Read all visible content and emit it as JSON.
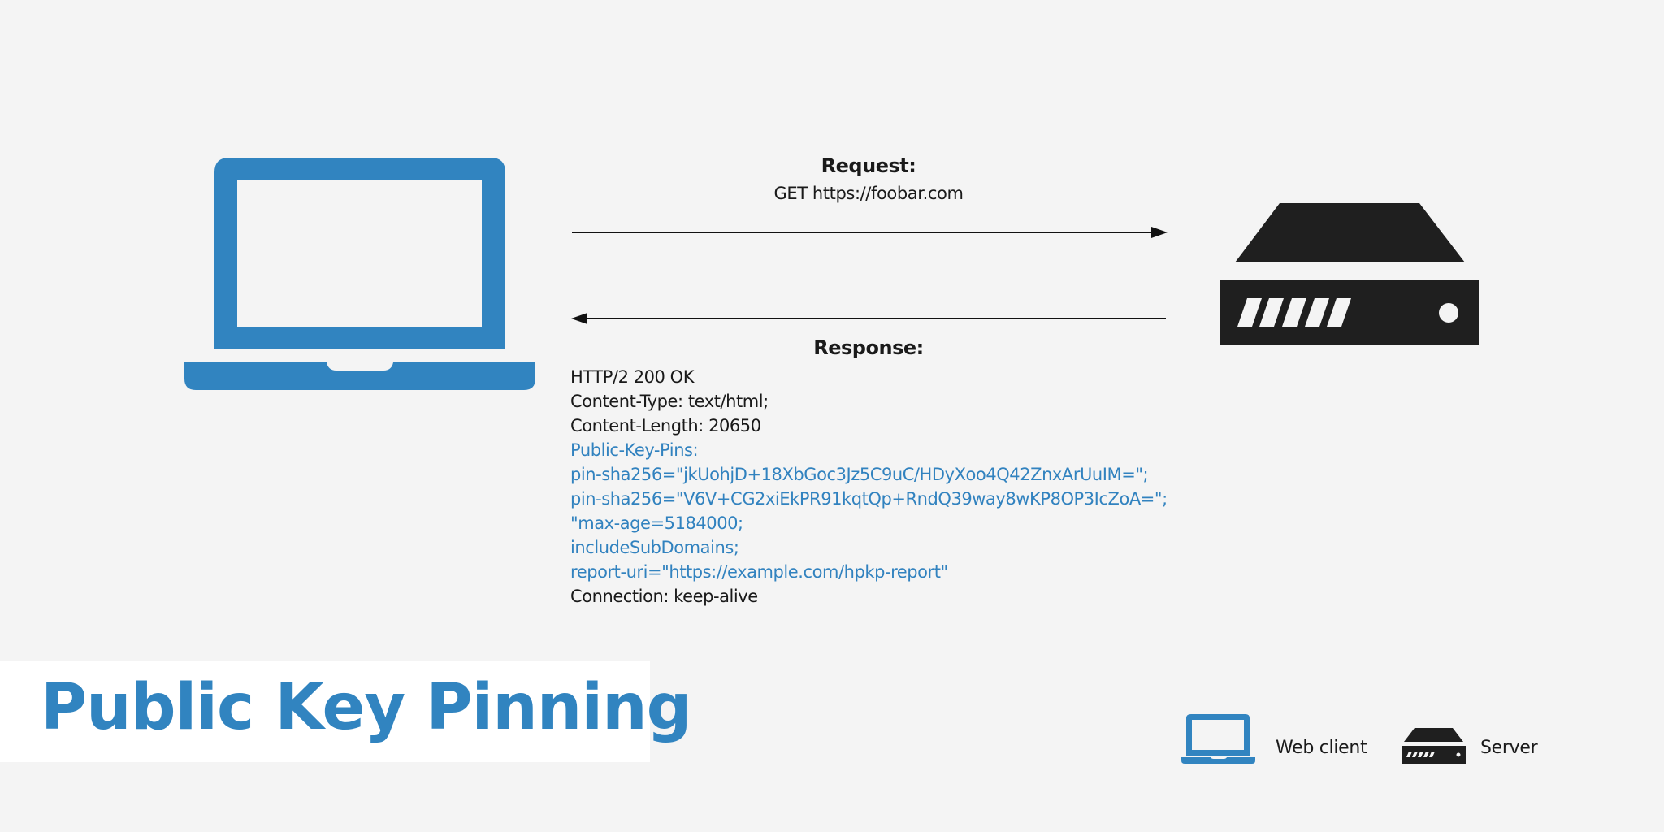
{
  "title": "Public Key Pinning",
  "colors": {
    "accent": "#3184c0",
    "server": "#1f1f1f",
    "background": "#f4f4f4",
    "text": "#1a1a1a"
  },
  "client": {
    "icon": "laptop-icon",
    "label": "Web client"
  },
  "server": {
    "icon": "server-icon",
    "label": "Server"
  },
  "request": {
    "heading": "Request:",
    "line": "GET https://foobar.com",
    "direction": "client-to-server"
  },
  "response": {
    "heading": "Response:",
    "direction": "server-to-client",
    "lines": [
      {
        "text": "HTTP/2 200 OK",
        "highlight": false
      },
      {
        "text": "Content-Type: text/html;",
        "highlight": false
      },
      {
        "text": "Content-Length: 20650",
        "highlight": false
      },
      {
        "text": "Public-Key-Pins:",
        "highlight": true
      },
      {
        "text": "pin-sha256=\"jkUohjD+18XbGoc3Jz5C9uC/HDyXoo4Q42ZnxArUuIM=\";",
        "highlight": true
      },
      {
        "text": "pin-sha256=\"V6V+CG2xiEkPR91kqtQp+RndQ39way8wKP8OP3IcZoA=\";",
        "highlight": true
      },
      {
        "text": "\"max-age=5184000;",
        "highlight": true
      },
      {
        "text": "includeSubDomains;",
        "highlight": true
      },
      {
        "text": "report-uri=\"https://example.com/hpkp-report\"",
        "highlight": true
      },
      {
        "text": "Connection: keep-alive",
        "highlight": false
      }
    ]
  },
  "legend": {
    "items": [
      {
        "icon": "laptop-icon",
        "label": "Web client"
      },
      {
        "icon": "server-icon",
        "label": "Server"
      }
    ]
  }
}
